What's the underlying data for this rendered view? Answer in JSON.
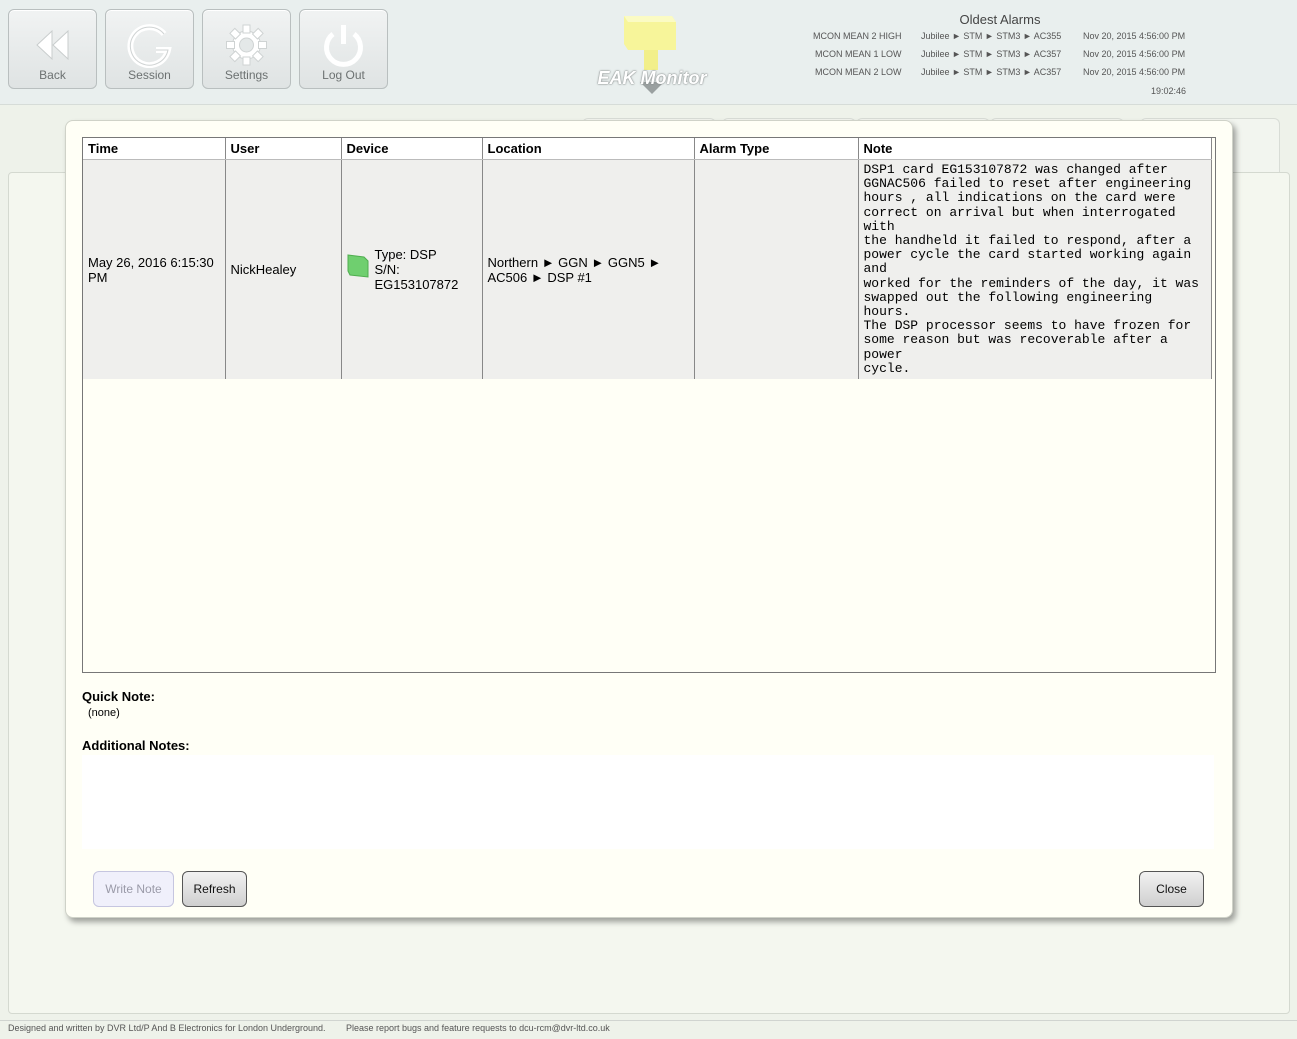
{
  "toolbar": {
    "back": "Back",
    "session": "Session",
    "settings": "Settings",
    "logout": "Log Out"
  },
  "logo": {
    "text": "EAK Monitor"
  },
  "oldest_alarms": {
    "title": "Oldest Alarms",
    "rows": [
      {
        "type": "MCON MEAN 2 HIGH",
        "location": "Jubilee ► STM ► STM3 ► AC355",
        "time": "Nov 20, 2015 4:56:00 PM"
      },
      {
        "type": "MCON MEAN 1 LOW",
        "location": "Jubilee ► STM ► STM3 ► AC357",
        "time": "Nov 20, 2015 4:56:00 PM"
      },
      {
        "type": "MCON MEAN 2 LOW",
        "location": "Jubilee ► STM ► STM3 ► AC357",
        "time": "Nov 20, 2015 4:56:00 PM"
      }
    ],
    "clock": "19:02:46"
  },
  "notes_table": {
    "headers": [
      "Time",
      "User",
      "Device",
      "Location",
      "Alarm Type",
      "Note"
    ],
    "rows": [
      {
        "time": "May 26, 2016 6:15:30 PM",
        "user": "NickHealey",
        "device_type": "Type: DSP",
        "device_sn_label": "S/N:",
        "device_sn": "EG153107872",
        "location": "Northern ► GGN ► GGN5 ► AC506 ► DSP #1",
        "alarm_type": "",
        "note": "DSP1 card EG153107872 was changed after\nGGNAC506 failed to reset after engineering\nhours , all indications on the card were\ncorrect on arrival but when interrogated with\nthe handheld it failed to respond, after a\npower cycle the card started working again and\nworked for the reminders of the day, it was\nswapped out the following engineering hours.\nThe DSP processor seems to have frozen for\nsome reason but was recoverable after a power\ncycle."
      }
    ]
  },
  "quick_note": {
    "label": "Quick Note:",
    "value": "(none)"
  },
  "additional_notes": {
    "label": "Additional Notes:",
    "value": ""
  },
  "buttons": {
    "write_note": "Write Note",
    "refresh": "Refresh",
    "close": "Close"
  },
  "footer": {
    "credit": "Designed and written by DVR Ltd/P And B Electronics for London Underground.",
    "bugs": "Please report bugs and feature requests to dcu-rcm@dvr-ltd.co.uk"
  },
  "colors": {
    "device_icon": "#6fcf6f",
    "logo_yellow": "#f7f59a"
  }
}
